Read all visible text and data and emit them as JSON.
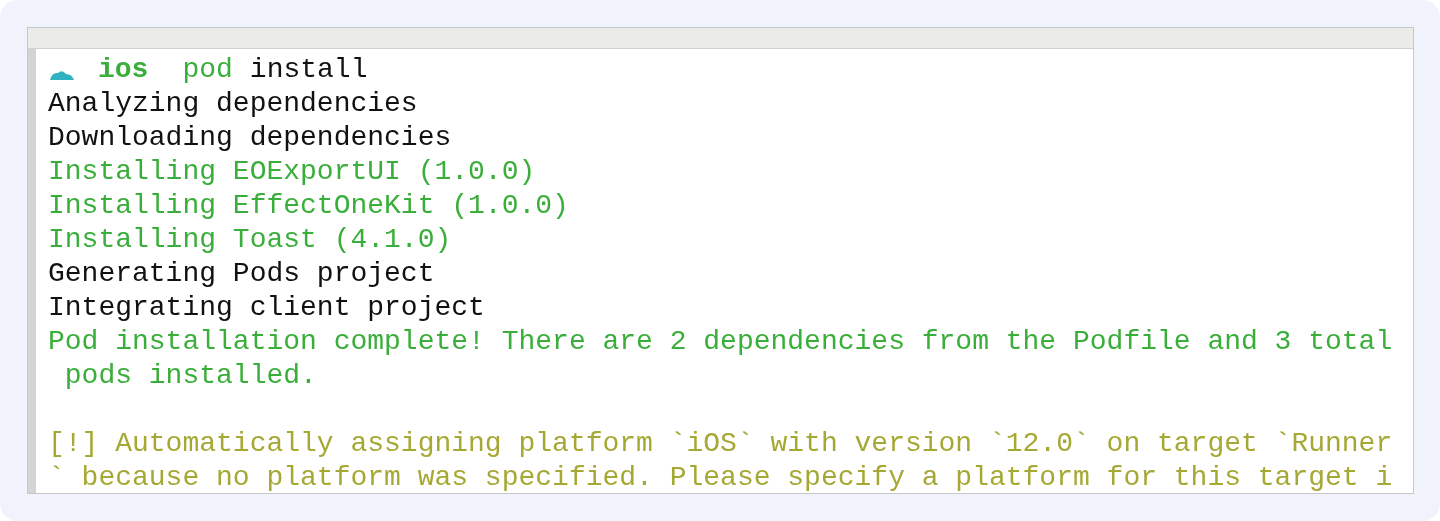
{
  "prompt": {
    "directory": "ios",
    "command": "pod",
    "args": "install"
  },
  "lines": [
    {
      "kind": "normal",
      "text": "Analyzing dependencies"
    },
    {
      "kind": "normal",
      "text": "Downloading dependencies"
    },
    {
      "kind": "success",
      "text": "Installing EOExportUI (1.0.0)"
    },
    {
      "kind": "success",
      "text": "Installing EffectOneKit (1.0.0)"
    },
    {
      "kind": "success",
      "text": "Installing Toast (4.1.0)"
    },
    {
      "kind": "normal",
      "text": "Generating Pods project"
    },
    {
      "kind": "normal",
      "text": "Integrating client project"
    },
    {
      "kind": "success",
      "text": "Pod installation complete! There are 2 dependencies from the Podfile and 3 total"
    },
    {
      "kind": "success",
      "text": " pods installed."
    },
    {
      "kind": "blank"
    },
    {
      "kind": "warning",
      "text": "[!] Automatically assigning platform `iOS` with version `12.0` on target `Runner"
    },
    {
      "kind": "warning",
      "text": "` because no platform was specified. Please specify a platform for this target i"
    }
  ]
}
